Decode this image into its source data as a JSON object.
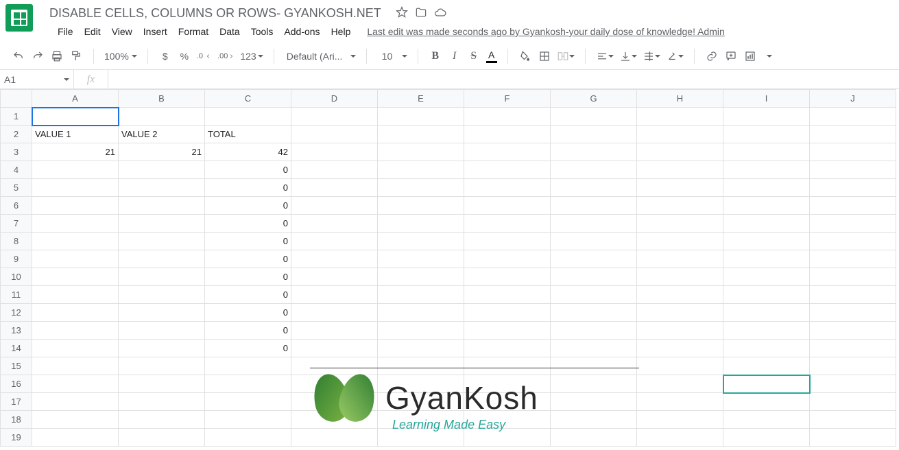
{
  "header": {
    "doc_title": "DISABLE CELLS, COLUMNS OR ROWS- GYANKOSH.NET"
  },
  "menu": {
    "items": [
      "File",
      "Edit",
      "View",
      "Insert",
      "Format",
      "Data",
      "Tools",
      "Add-ons",
      "Help"
    ],
    "last_edit": "Last edit was made seconds ago by Gyankosh-your daily dose of knowledge! Admin"
  },
  "toolbar": {
    "zoom": "100%",
    "currency": "$",
    "percent": "%",
    "dec_dec": ".0",
    "dec_inc": ".00",
    "more_formats": "123",
    "font_name": "Default (Ari...",
    "font_size": "10",
    "bold": "B",
    "italic": "I",
    "strike": "S",
    "text_color": "A"
  },
  "name_box": {
    "value": "A1"
  },
  "fx": {
    "label": "fx",
    "value": ""
  },
  "columns": [
    "A",
    "B",
    "C",
    "D",
    "E",
    "F",
    "G",
    "H",
    "I",
    "J"
  ],
  "rows_count": 19,
  "selected_col": "A",
  "active_cell": "A1",
  "other_highlight": "I16",
  "cells": {
    "A2": {
      "v": "VALUE 1",
      "t": "s"
    },
    "B2": {
      "v": "VALUE 2",
      "t": "s"
    },
    "C2": {
      "v": "TOTAL",
      "t": "s"
    },
    "A3": {
      "v": "21",
      "t": "n"
    },
    "B3": {
      "v": "21",
      "t": "n"
    },
    "C3": {
      "v": "42",
      "t": "n"
    },
    "C4": {
      "v": "0",
      "t": "n"
    },
    "C5": {
      "v": "0",
      "t": "n"
    },
    "C6": {
      "v": "0",
      "t": "n"
    },
    "C7": {
      "v": "0",
      "t": "n"
    },
    "C8": {
      "v": "0",
      "t": "n"
    },
    "C9": {
      "v": "0",
      "t": "n"
    },
    "C10": {
      "v": "0",
      "t": "n"
    },
    "C11": {
      "v": "0",
      "t": "n"
    },
    "C12": {
      "v": "0",
      "t": "n"
    },
    "C13": {
      "v": "0",
      "t": "n"
    },
    "C14": {
      "v": "0",
      "t": "n"
    }
  },
  "watermark": {
    "brand": "GyanKosh",
    "tagline": "Learning Made Easy"
  }
}
